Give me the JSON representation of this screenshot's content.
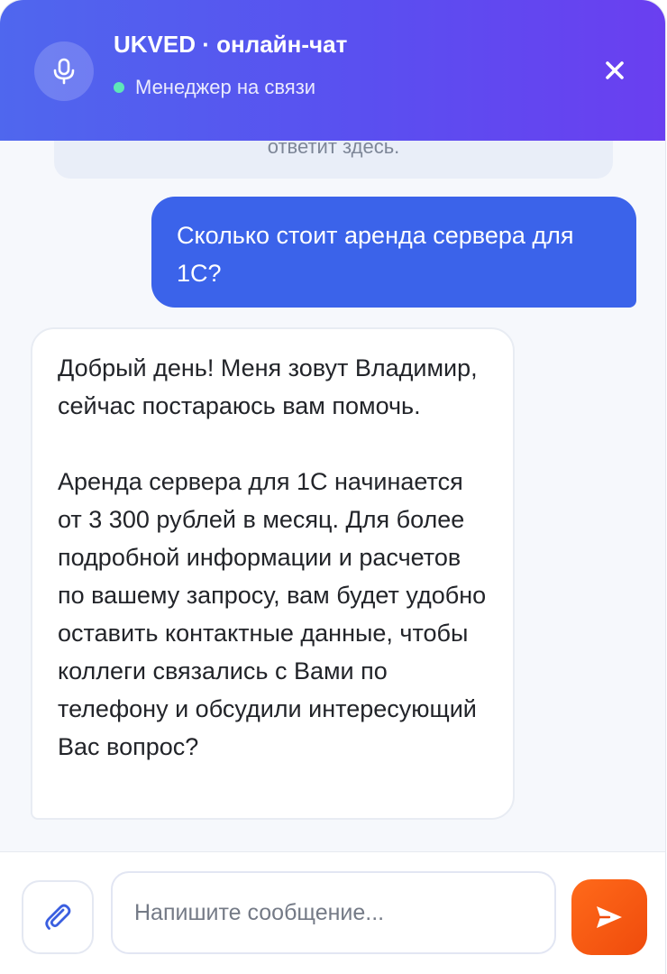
{
  "header": {
    "title": "UKVED · онлайн-чат",
    "status": "Менеджер на связи",
    "status_color": "#5ee6b8",
    "gradient": [
      "#4f67ee",
      "#6a3ff0"
    ],
    "icons": {
      "mic": "microphone-icon",
      "close": "close-icon"
    }
  },
  "messages": {
    "system_partial": "ответит здесь.",
    "user": "Сколько стоит аренда сервера для 1С?",
    "agent": "Добрый день! Меня зовут Владимир, сейчас постараюсь вам помочь.\n\nАренда сервера для 1С начинается от 3 300 рублей в месяц. Для более подробной информации и расчетов по вашему запросу, вам будет удобно оставить контактные данные, чтобы коллеги связались с Вами по телефону и обсудили интересующий Вас вопрос?"
  },
  "composer": {
    "placeholder": "Напишите сообщение...",
    "value": "",
    "icons": {
      "attach": "paperclip-icon",
      "send": "send-icon"
    },
    "send_color": "#f2561b"
  },
  "colors": {
    "user_bubble": "#3b63ea",
    "agent_bubble": "#ffffff",
    "background": "#f6f8fc"
  }
}
